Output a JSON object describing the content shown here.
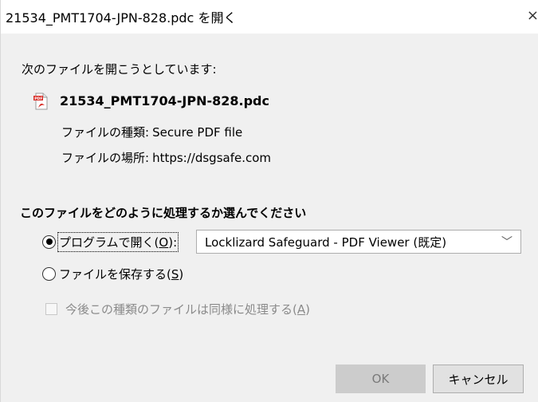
{
  "window": {
    "title": "21534_PMT1704-JPN-828.pdc を開く",
    "close_glyph": "×"
  },
  "intro_text": "次のファイルを開こうとしています:",
  "file": {
    "name": "21534_PMT1704-JPN-828.pdc",
    "type_label": "ファイルの種類:",
    "type_value": "Secure PDF file",
    "location_label": "ファイルの場所:",
    "location_value": "https://dsgsafe.com"
  },
  "action_heading": "このファイルをどのように処理するか選んでください",
  "options": {
    "open_with": {
      "label": "プログラムで開く(",
      "accesskey": "O",
      "suffix": "):",
      "selected": true
    },
    "save_file": {
      "label": "ファイルを保存する(",
      "accesskey": "S",
      "suffix": ")",
      "selected": false
    }
  },
  "program_select": {
    "value": "Locklizard Safeguard - PDF Viewer (既定)",
    "chevron": "﹀"
  },
  "remember": {
    "label": "今後この種類のファイルは同様に処理する(",
    "accesskey": "A",
    "suffix": ")",
    "checked": false,
    "enabled": false
  },
  "buttons": {
    "ok": "OK",
    "cancel": "キャンセル"
  },
  "colors": {
    "dialog_bg": "#f0f0f0",
    "titlebar_bg": "#ffffff",
    "disabled_text": "#8a8a8a",
    "ok_disabled_bg": "#cccccc",
    "pdf_icon_red": "#d9302a"
  }
}
